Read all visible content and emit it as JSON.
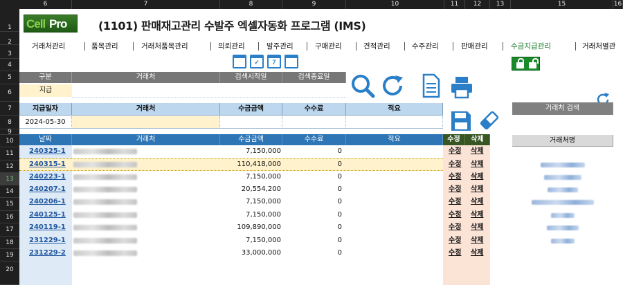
{
  "app": {
    "logo_text_a": "Cell",
    "logo_text_b": "Pro",
    "title": "(1101) 판매재고관리 수발주 엑셀자동화 프로그램 (IMS)"
  },
  "excel": {
    "columns": [
      "6",
      "7",
      "8",
      "9",
      "10",
      "11",
      "12",
      "13",
      "15",
      "16"
    ],
    "rows": [
      "1",
      "2",
      "3",
      "4",
      "5",
      "6",
      "7",
      "8",
      "9",
      "10",
      "11",
      "12",
      "13",
      "14",
      "15",
      "16",
      "17",
      "18",
      "19",
      "20"
    ],
    "selected_row": "13"
  },
  "menu": [
    "거래처관리",
    "품목관리",
    "거래처품목관리",
    "의뢰관리",
    "발주관리",
    "구매관리",
    "견적관리",
    "수주관리",
    "판매관리",
    "수금지급관리",
    "거래처별관"
  ],
  "menu_active": "수금지급관리",
  "calendar_icons": [
    "",
    "✓",
    "7",
    ""
  ],
  "search_panel": {
    "col_type": "구분",
    "col_vendor": "거래처",
    "col_start": "검색시작일",
    "col_end": "검색종료일",
    "type_value": "지급"
  },
  "entry": {
    "col_date": "지급일자",
    "col_vendor": "거래처",
    "col_amount": "수금금액",
    "col_fee": "수수료",
    "col_memo": "적요",
    "date_value": "2024-05-30"
  },
  "vendor_search": {
    "button": "거래처 검색",
    "header": "거래처명",
    "count": 7
  },
  "list": {
    "headers": {
      "date": "날짜",
      "vendor": "거래처",
      "amount": "수금금액",
      "fee": "수수료",
      "memo": "적요",
      "edit": "수정",
      "delete": "삭제"
    },
    "rows": [
      {
        "code": "240325-1",
        "amount": "7,150,000",
        "fee": "0"
      },
      {
        "code": "240315-1",
        "amount": "110,418,000",
        "fee": "0"
      },
      {
        "code": "240223-1",
        "amount": "7,150,000",
        "fee": "0"
      },
      {
        "code": "240207-1",
        "amount": "20,554,200",
        "fee": "0"
      },
      {
        "code": "240206-1",
        "amount": "7,150,000",
        "fee": "0"
      },
      {
        "code": "240125-1",
        "amount": "7,150,000",
        "fee": "0"
      },
      {
        "code": "240119-1",
        "amount": "109,890,000",
        "fee": "0"
      },
      {
        "code": "231229-1",
        "amount": "7,150,000",
        "fee": "0"
      },
      {
        "code": "231229-2",
        "amount": "33,000,000",
        "fee": "0"
      }
    ],
    "highlight_index": 1,
    "edit_label": "수정",
    "delete_label": "삭제"
  },
  "colors": {
    "accent_blue": "#2e75b6",
    "header_gray": "#777777",
    "active_menu": "#1b7d2a",
    "highlight": "#fff2cc"
  }
}
